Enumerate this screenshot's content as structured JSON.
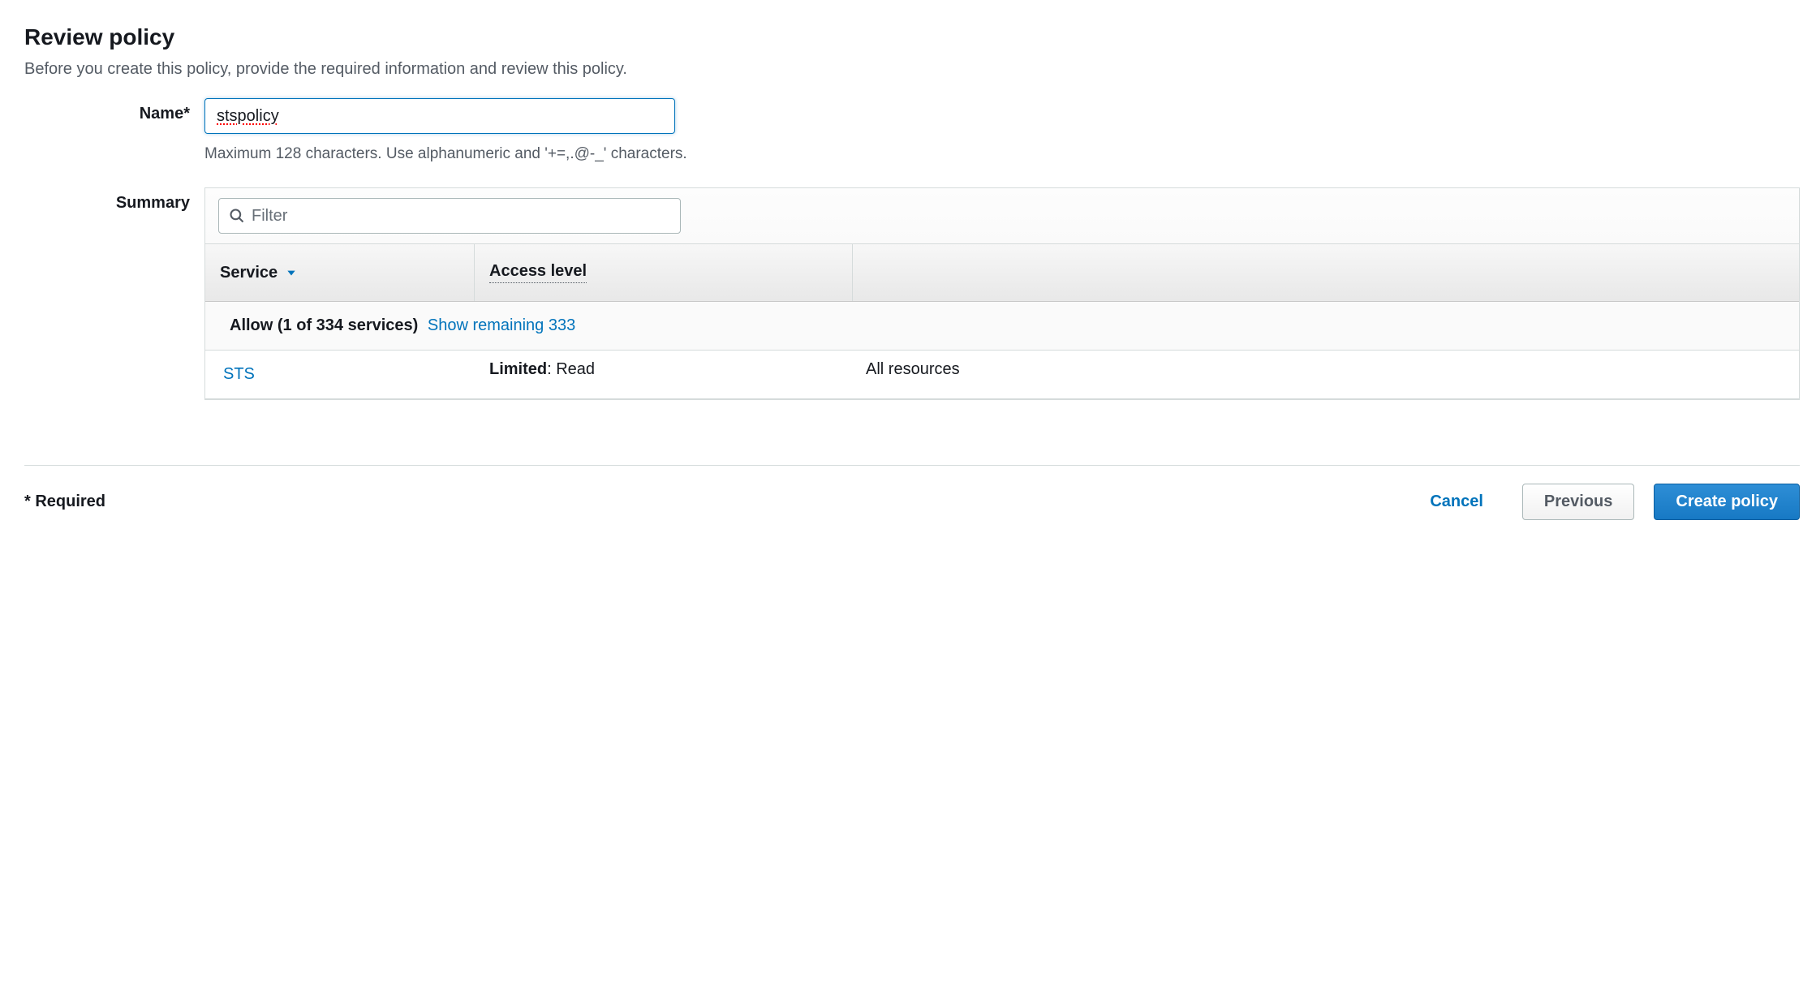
{
  "header": {
    "title": "Review policy",
    "subtitle": "Before you create this policy, provide the required information and review this policy."
  },
  "form": {
    "name_label": "Name*",
    "name_value": "stspolicy",
    "name_hint": "Maximum 128 characters. Use alphanumeric and '+=,.@-_' characters.",
    "summary_label": "Summary"
  },
  "filter": {
    "placeholder": "Filter"
  },
  "columns": {
    "service": "Service",
    "access_level": "Access level"
  },
  "group": {
    "allow_text": "Allow (1 of 334 services)",
    "show_link": "Show remaining 333"
  },
  "rows": [
    {
      "service": "STS",
      "access_limited": "Limited",
      "access_suffix": ": Read",
      "resource": "All resources"
    }
  ],
  "footer": {
    "required": "* Required",
    "cancel": "Cancel",
    "previous": "Previous",
    "create": "Create policy"
  }
}
